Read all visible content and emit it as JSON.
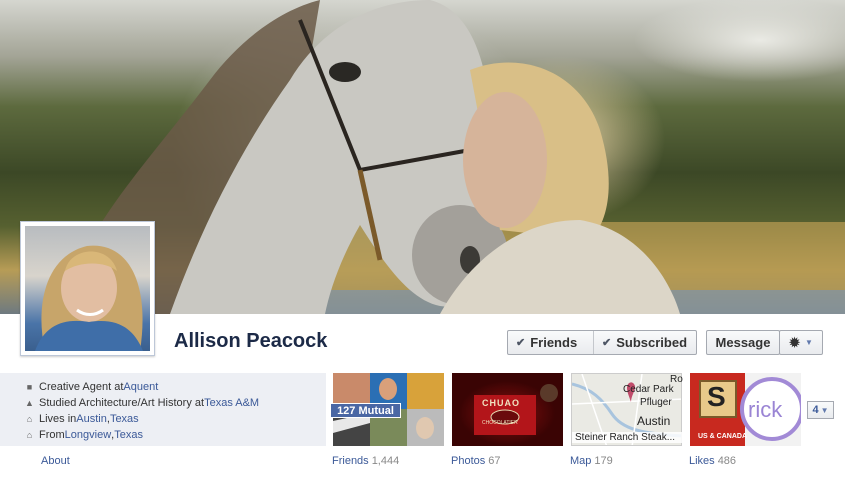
{
  "profile": {
    "name": "Allison Peacock"
  },
  "actions": {
    "friends_label": "Friends",
    "subscribed_label": "Subscribed",
    "message_label": "Message"
  },
  "info": [
    {
      "icon": "briefcase-icon",
      "text": "Creative Agent at ",
      "link": "Aquent",
      "text2": "",
      "link2": ""
    },
    {
      "icon": "graduation-icon",
      "text": "Studied Architecture/Art History at ",
      "link": "Texas A&M",
      "text2": "",
      "link2": ""
    },
    {
      "icon": "house-icon",
      "text": "Lives in ",
      "link": "Austin",
      "text2": ", ",
      "link2": "Texas"
    },
    {
      "icon": "home-icon",
      "text": "From ",
      "link": "Longview",
      "text2": ", ",
      "link2": "Texas"
    }
  ],
  "about_label": "About",
  "tiles": {
    "mutual_badge": "127 Mutual",
    "photos_brand": "CHUAO",
    "photos_subbrand": "CHOCOLATIER",
    "map_labels": [
      "Cedar Park",
      "Pfluger",
      "Ro"
    ],
    "map_city": "Austin",
    "map_caption": "Steiner Ranch Steak...",
    "likes_logo_letter": "S",
    "likes_logo_text": "US & CANADA",
    "likes_circle_text": "rick"
  },
  "tabs": {
    "friends": {
      "label": "Friends",
      "count": "1,444"
    },
    "photos": {
      "label": "Photos",
      "count": "67"
    },
    "map": {
      "label": "Map",
      "count": "179"
    },
    "likes": {
      "label": "Likes",
      "count": "486"
    }
  },
  "more_count": "4",
  "colors": {
    "link": "#3b5998",
    "name": "#1c2a47",
    "panel": "#edeff4"
  }
}
